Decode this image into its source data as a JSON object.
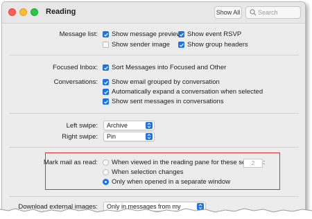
{
  "window": {
    "title": "Reading",
    "show_all": "Show All",
    "search_placeholder": "Search"
  },
  "message_list": {
    "label": "Message list:",
    "options": [
      {
        "label": "Show message preview",
        "checked": true
      },
      {
        "label": "Show event RSVP",
        "checked": true
      },
      {
        "label": "Show sender image",
        "checked": false
      },
      {
        "label": "Show group headers",
        "checked": true
      }
    ]
  },
  "focused_inbox": {
    "label": "Focused Inbox:",
    "option": {
      "label": "Sort Messages into Focused and Other",
      "checked": true
    }
  },
  "conversations": {
    "label": "Conversations:",
    "options": [
      {
        "label": "Show email grouped by conversation",
        "checked": true
      },
      {
        "label": "Automatically expand a conversation when selected",
        "checked": true
      },
      {
        "label": "Show sent messages in conversations",
        "checked": true
      }
    ]
  },
  "swipe": {
    "left_label": "Left swipe:",
    "left_value": "Archive",
    "right_label": "Right swipe:",
    "right_value": "Pin"
  },
  "mark_read": {
    "label": "Mark mail as read:",
    "options": [
      {
        "label": "When viewed in the reading pane for these seconds:",
        "selected": false
      },
      {
        "label": "When selection changes",
        "selected": false
      },
      {
        "label": "Only when opened in a separate window",
        "selected": true
      }
    ],
    "seconds": "2"
  },
  "download_images": {
    "label": "Download external images:",
    "value": "Only in messages from my contacts"
  },
  "colors": {
    "accent": "#1a73e8",
    "highlight_box": "#e03030"
  }
}
